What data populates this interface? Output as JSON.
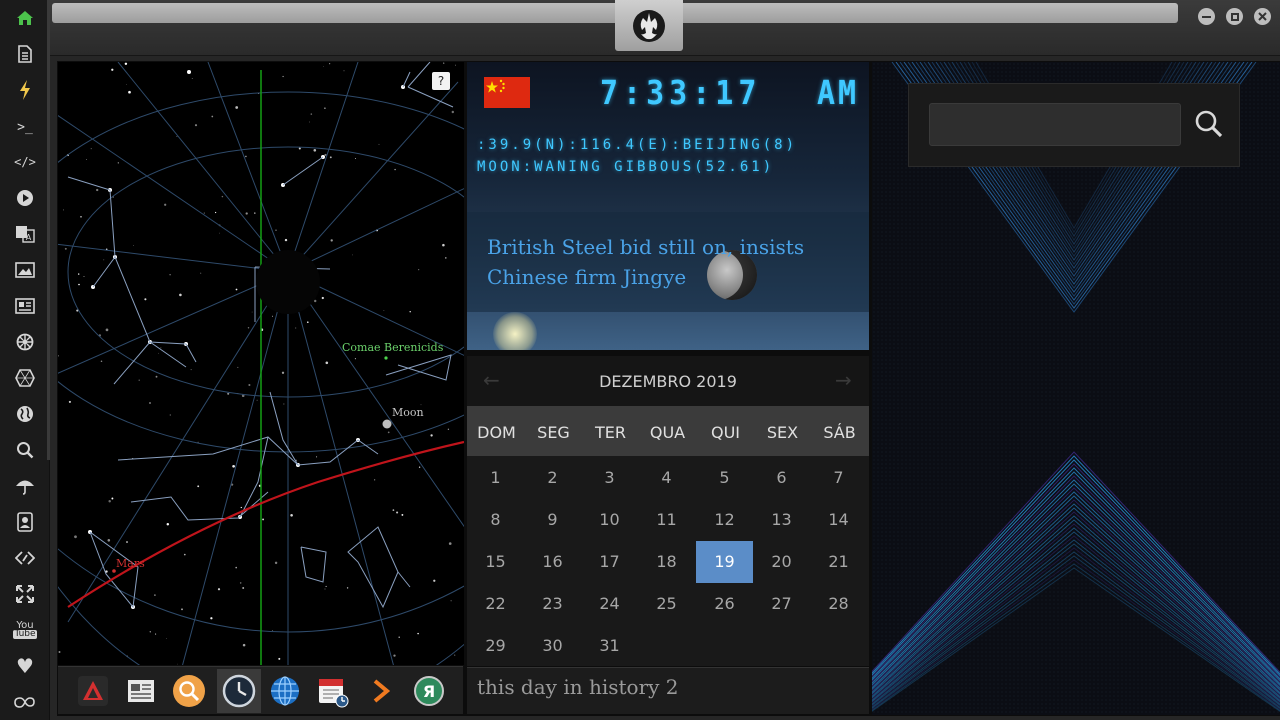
{
  "sidebar": {
    "items": [
      {
        "name": "home-icon",
        "glyph": "⌂"
      },
      {
        "name": "document-icon",
        "glyph": "▤"
      },
      {
        "name": "lightning-icon",
        "glyph": "ϟ"
      },
      {
        "name": "terminal-icon",
        "glyph": ">_"
      },
      {
        "name": "code-icon",
        "glyph": "</>"
      },
      {
        "name": "play-icon",
        "glyph": "▶"
      },
      {
        "name": "translate-icon",
        "glyph": "A"
      },
      {
        "name": "image-icon",
        "glyph": "▨"
      },
      {
        "name": "newspaper-icon",
        "glyph": "▦"
      },
      {
        "name": "empire-icon",
        "glyph": "✲"
      },
      {
        "name": "hexagon-icon",
        "glyph": "⬡"
      },
      {
        "name": "globe-icon",
        "glyph": "◍"
      },
      {
        "name": "search-icon",
        "glyph": "⌕"
      },
      {
        "name": "umbrella-icon",
        "glyph": "☂"
      },
      {
        "name": "contacts-icon",
        "glyph": "▣"
      },
      {
        "name": "link-icon",
        "glyph": "◇"
      },
      {
        "name": "expand-icon",
        "glyph": "✛"
      },
      {
        "name": "youtube-icon",
        "glyph": "You"
      },
      {
        "name": "heart-icon",
        "glyph": "♥"
      },
      {
        "name": "cloud-icon",
        "glyph": "∞"
      }
    ]
  },
  "sky": {
    "help_label": "?",
    "labels": {
      "comae": "Comae Berenicids",
      "moon": "Moon",
      "mars": "Mars"
    }
  },
  "clock": {
    "time": "7:33:17",
    "ampm": "AM",
    "geo": ":39.9(N):116.4(E):BEIJING(8)",
    "moon_phase": "MOON:WANING GIBBOUS(52.61)",
    "news": "British Steel bid still on, insists Chinese firm Jingye"
  },
  "calendar": {
    "title": "DEZEMBRO 2019",
    "prev": "←",
    "next": "→",
    "weekdays": [
      "DOM",
      "SEG",
      "TER",
      "QUA",
      "QUI",
      "SEX",
      "SÁB"
    ],
    "weeks": [
      [
        "1",
        "2",
        "3",
        "4",
        "5",
        "6",
        "7"
      ],
      [
        "8",
        "9",
        "10",
        "11",
        "12",
        "13",
        "14"
      ],
      [
        "15",
        "16",
        "17",
        "18",
        "19",
        "20",
        "21"
      ],
      [
        "22",
        "23",
        "24",
        "25",
        "26",
        "27",
        "28"
      ],
      [
        "29",
        "30",
        "31",
        "",
        "",
        "",
        ""
      ]
    ],
    "today": "19"
  },
  "history": {
    "label": "this day in history 2"
  },
  "search": {
    "value": "",
    "placeholder": ""
  },
  "dock": {
    "apps": [
      {
        "name": "arch-app-icon"
      },
      {
        "name": "news-app-icon"
      },
      {
        "name": "search-app-icon"
      },
      {
        "name": "clock-app-icon"
      },
      {
        "name": "globe-app-icon"
      },
      {
        "name": "calendar-app-icon"
      },
      {
        "name": "arrow-app-icon"
      },
      {
        "name": "yandex-app-icon"
      }
    ]
  },
  "colors": {
    "lcd": "#3fc8ff",
    "today": "#5b8dc8",
    "ecliptic": "#c0141b",
    "meridian": "#14a014",
    "news": "#4aa3e8"
  }
}
